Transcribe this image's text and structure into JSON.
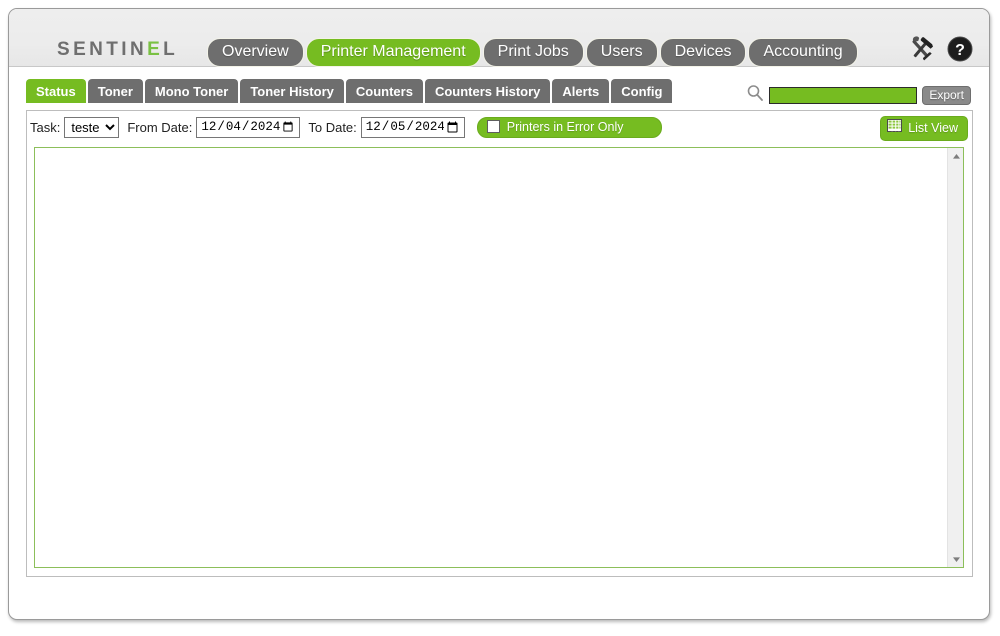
{
  "app": {
    "brand_prefix": "SENTIN",
    "brand_accent": "E",
    "brand_suffix": "L",
    "accent_color": "#76bc21",
    "nav_inactive_color": "#6e6e6e"
  },
  "header": {
    "nav_tabs": [
      {
        "label": "Overview",
        "active": false
      },
      {
        "label": "Printer Management",
        "active": true
      },
      {
        "label": "Print Jobs",
        "active": false
      },
      {
        "label": "Users",
        "active": false
      },
      {
        "label": "Devices",
        "active": false
      },
      {
        "label": "Accounting",
        "active": false
      }
    ],
    "icons": [
      {
        "name": "tools-icon",
        "title": "Tools"
      },
      {
        "name": "help-icon",
        "title": "Help"
      }
    ]
  },
  "subtabs": [
    {
      "label": "Status",
      "active": true
    },
    {
      "label": "Toner",
      "active": false
    },
    {
      "label": "Mono Toner",
      "active": false
    },
    {
      "label": "Toner History",
      "active": false
    },
    {
      "label": "Counters",
      "active": false
    },
    {
      "label": "Counters History",
      "active": false
    },
    {
      "label": "Alerts",
      "active": false
    },
    {
      "label": "Config",
      "active": false
    }
  ],
  "search": {
    "value": "",
    "placeholder": "",
    "icon": "search-icon",
    "export_label": "Export"
  },
  "toolbar": {
    "task_label": "Task:",
    "task_value": "teste",
    "task_options": [
      "teste"
    ],
    "from_date_label": "From Date:",
    "from_date_value": "12/04/2024",
    "to_date_label": "To Date:",
    "to_date_value": "12/05/2024",
    "error_only_label": "Printers in Error Only",
    "error_only_checked": false,
    "list_view_label": "List View",
    "list_view_icon": "grid-icon"
  },
  "content": {
    "rows": [],
    "empty": true
  }
}
